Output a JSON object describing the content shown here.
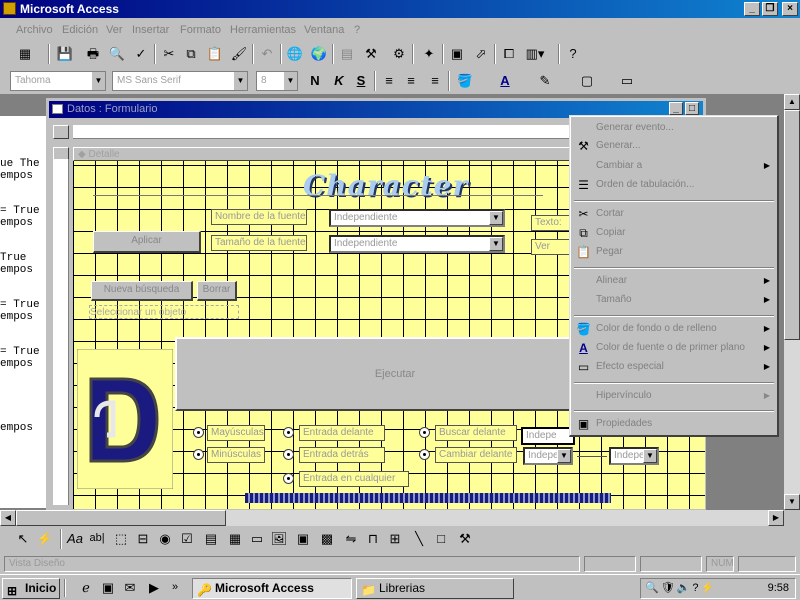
{
  "window": {
    "title": "Microsoft Access"
  },
  "menubar": [
    "Archivo",
    "Edición",
    "Ver",
    "Insertar",
    "Formato",
    "Herramientas",
    "Ventana",
    "?"
  ],
  "format_toolbar": {
    "font": "Tahoma",
    "font_name": "MS Sans Serif",
    "size": "8"
  },
  "left_pane_lines": [
    "ue The",
    "empos",
    "",
    "= True",
    "empos",
    "",
    "  True",
    "empos",
    "",
    "= True",
    "empos",
    "",
    "= True",
    "empos",
    "",
    "",
    "",
    "empos"
  ],
  "form_window": {
    "title": "Datos : Formulario",
    "section": "Detalle"
  },
  "form": {
    "heading": "Character",
    "labels": {
      "nombre_fuente": "Nombre de la fuente",
      "tamano_fuente": "Tamaño de la fuente",
      "texto": "Texto:",
      "ver": "Ver"
    },
    "combo_values": {
      "combo1": "Independiente",
      "combo2": "Independiente",
      "combo3": "Indepe",
      "combo4": "Indepe",
      "combo5": "Indepe"
    },
    "buttons": {
      "aplicar": "Aplicar",
      "nueva_busqueda": "Nueva búsqueda",
      "borrar": "Borrar",
      "ejecutar": "Ejecutar"
    },
    "field_hint": "Seleccionar un objeto",
    "radio_labels": [
      "Mayúsculas",
      "Minúsculas",
      "Entrada delante",
      "Entrada detrás",
      "Entrada en cualquier",
      "Buscar delante",
      "Cambiar delante"
    ]
  },
  "context_menu": {
    "items": [
      {
        "label": "Generar evento...",
        "icon": "",
        "submenu": false
      },
      {
        "label": "Generar...",
        "icon": "builder-icon",
        "submenu": false
      },
      {
        "label": "Cambiar a",
        "icon": "",
        "submenu": true
      },
      {
        "label": "Orden de tabulación...",
        "icon": "tab-order-icon",
        "submenu": false
      },
      "sep",
      {
        "label": "Cortar",
        "icon": "cut-icon",
        "submenu": false
      },
      {
        "label": "Copiar",
        "icon": "copy-icon",
        "submenu": false
      },
      {
        "label": "Pegar",
        "icon": "paste-icon",
        "submenu": false
      },
      "sep",
      {
        "label": "Alinear",
        "icon": "",
        "submenu": true
      },
      {
        "label": "Tamaño",
        "icon": "",
        "submenu": true
      },
      "sep",
      {
        "label": "Color de fondo o de relleno",
        "icon": "fill-color-icon",
        "submenu": true
      },
      {
        "label": "Color de fuente o de primer plano",
        "icon": "font-color-icon",
        "submenu": true
      },
      {
        "label": "Efecto especial",
        "icon": "special-effect-icon",
        "submenu": true
      },
      "sep",
      {
        "label": "Hipervínculo",
        "icon": "",
        "submenu": true
      },
      "sep",
      {
        "label": "Propiedades",
        "icon": "properties-icon",
        "submenu": false
      }
    ]
  },
  "statusbar": {
    "message": "Vista Diseño",
    "num": "NUM"
  },
  "taskbar": {
    "start": "Inicio",
    "tasks": [
      "Microsoft Access",
      "Librerias"
    ],
    "clock": "9:58"
  },
  "colors": {
    "canvas": "#ffff99",
    "titlebar": "#000080",
    "logo": "#1a1a80"
  }
}
